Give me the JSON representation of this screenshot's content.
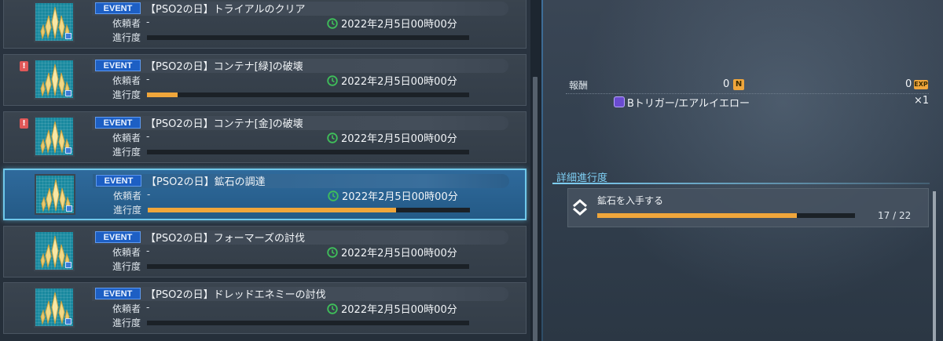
{
  "quests": [
    {
      "badge": "EVENT",
      "title": "【PSO2の日】トライアルのクリア",
      "requester_label": "依頼者",
      "requester": "-",
      "progress_label": "進行度",
      "date": "2022年2月5日00時00分",
      "progress": 0.0,
      "alert": false,
      "alert_text": "",
      "selected": false
    },
    {
      "badge": "EVENT",
      "title": "【PSO2の日】コンテナ[緑]の破壊",
      "requester_label": "依頼者",
      "requester": "-",
      "progress_label": "進行度",
      "date": "2022年2月5日00時00分",
      "progress": 0.095,
      "alert": true,
      "alert_text": "!",
      "selected": false
    },
    {
      "badge": "EVENT",
      "title": "【PSO2の日】コンテナ[金]の破壊",
      "requester_label": "依頼者",
      "requester": "-",
      "progress_label": "進行度",
      "date": "2022年2月5日00時00分",
      "progress": 0.0,
      "alert": true,
      "alert_text": "!",
      "selected": false
    },
    {
      "badge": "EVENT",
      "title": "【PSO2の日】鉱石の調達",
      "requester_label": "依頼者",
      "requester": "-",
      "progress_label": "進行度",
      "date": "2022年2月5日00時00分",
      "progress": 0.77,
      "alert": false,
      "alert_text": "",
      "selected": true
    },
    {
      "badge": "EVENT",
      "title": "【PSO2の日】フォーマーズの討伐",
      "requester_label": "依頼者",
      "requester": "-",
      "progress_label": "進行度",
      "date": "2022年2月5日00時00分",
      "progress": 0.0,
      "alert": false,
      "alert_text": "",
      "selected": false
    },
    {
      "badge": "EVENT",
      "title": "【PSO2の日】ドレッドエネミーの討伐",
      "requester_label": "依頼者",
      "requester": "-",
      "progress_label": "進行度",
      "date": "2022年2月5日00時00分",
      "progress": 0.0,
      "alert": false,
      "alert_text": "",
      "selected": false
    }
  ],
  "detail": {
    "reward_label": "報酬",
    "meseta": "0",
    "meseta_icon": "N",
    "exp": "0",
    "exp_icon": "EXP",
    "item_name": "Bトリガー/エアルイエロー",
    "item_qty": "×1",
    "section_title": "詳細進行度",
    "objective_text": "鉱石を入手する",
    "objective_count": "17 / 22",
    "objective_progress": 0.773
  },
  "colors": {
    "accent": "#7fd0f5",
    "progress": "#f0a63b",
    "event_badge": "#1d5fc4",
    "selected_bg": "#2a6393",
    "clock": "#3fbf5a"
  },
  "icons": {
    "quest": "crystal-spire-icon",
    "clock": "clock-icon",
    "meseta": "meseta-icon",
    "exp": "exp-icon",
    "item": "trigger-item-icon",
    "objective": "objective-chevron-icon",
    "alert": "alert-icon"
  }
}
